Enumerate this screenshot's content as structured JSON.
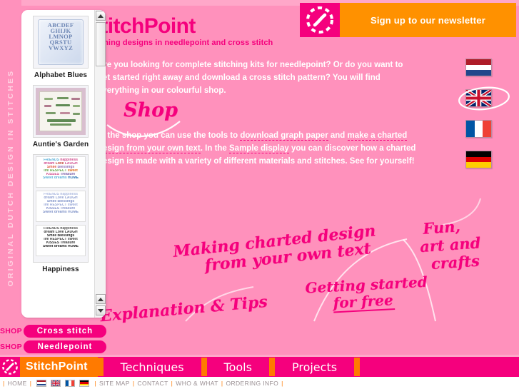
{
  "site": {
    "vertical_tagline": "ORIGINAL DUTCH DESIGN IN STITCHES",
    "brand": "StitchPoint",
    "tagline": "stitching designs in needlepoint and cross stitch",
    "logo_icon": "spiral-stitch-logo-icon"
  },
  "newsletter": {
    "label": "Sign up to our newsletter",
    "logo_icon": "spiral-stitch-logo-icon",
    "bar_color": "#ff9100",
    "logo_color": "#f5007d"
  },
  "panel": {
    "products": [
      {
        "name": "Alphabet Blues",
        "art": "alphabet-pillow"
      },
      {
        "name": "Auntie's Garden",
        "art": "garden-sampler"
      },
      {
        "name": "Happiness",
        "art": "word-art-sampler"
      }
    ],
    "scrollbar": {
      "up_arrow": "scroll-up-arrow-icon",
      "down_arrow": "scroll-down-arrow-icon"
    }
  },
  "main": {
    "paragraph1": "Are you looking for complete stitching kits for needlepoint? Or do you want to get started right away and download a cross stitch pattern? You will find everything in our colourful shop.",
    "paragraph2_a": "In the shop you can use the tools to ",
    "paragraph2_link1": "download graph paper",
    "paragraph2_b": " and ",
    "paragraph2_link2": "make a charted design from your own text",
    "paragraph2_c": ". In the ",
    "paragraph2_link3": "Sample display",
    "paragraph2_d": " you can discover how a charted design is made with a variety of different materials and stitches. See for yourself!"
  },
  "script_notes": {
    "shop": "Shop",
    "making_l1": "Making charted design",
    "making_l2": "from your own text",
    "getting_l1": "Getting started",
    "getting_l2": "for free",
    "fun_l1": "Fun,",
    "fun_l2": "art and",
    "fun_l3": "crafts",
    "explanation": "Explanation & Tips"
  },
  "languages": [
    {
      "code": "nl",
      "name": "Dutch",
      "selected": false
    },
    {
      "code": "en",
      "name": "English",
      "selected": true
    },
    {
      "code": "fr",
      "name": "French",
      "selected": false
    },
    {
      "code": "de",
      "name": "German",
      "selected": false
    }
  ],
  "shop_buttons": [
    {
      "prefix": "SHOP",
      "label": "Cross stitch"
    },
    {
      "prefix": "SHOP",
      "label": "Needlepoint"
    }
  ],
  "nav": {
    "brand": "StitchPoint",
    "logo_icon": "spiral-stitch-logo-icon",
    "items": [
      "Techniques",
      "Tools",
      "Projects"
    ]
  },
  "footer": {
    "home": "HOME",
    "links": [
      "SITE MAP",
      "CONTACT",
      "WHO & WHAT",
      "ORDERING INFO"
    ],
    "separator": "|"
  },
  "colors": {
    "background": "#ff91bc",
    "band": "#ffa7c9",
    "accent_pink": "#f5007d",
    "accent_orange": "#ff7a00",
    "newsletter_orange": "#ff9100",
    "text_white": "#ffffff",
    "tagline_light": "#ffd0e1"
  }
}
